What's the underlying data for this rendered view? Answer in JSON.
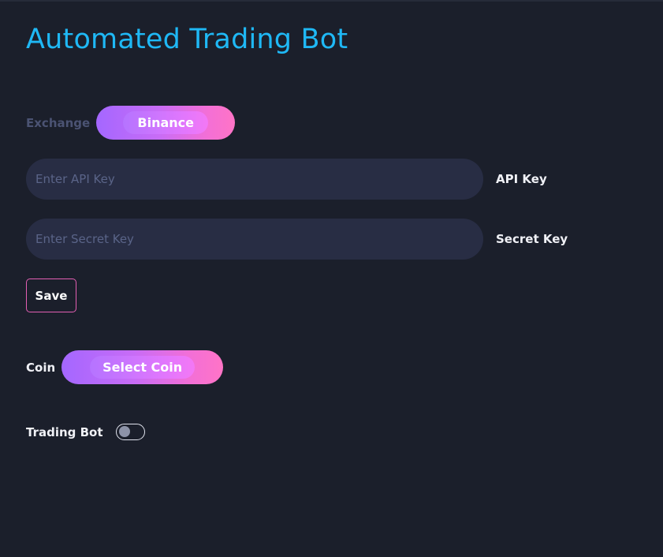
{
  "header": {
    "title": "Automated Trading Bot"
  },
  "exchange": {
    "label": "Exchange",
    "selected": "Binance"
  },
  "api_key": {
    "placeholder": "Enter API Key",
    "value": "",
    "label": "API Key"
  },
  "secret_key": {
    "placeholder": "Enter Secret Key",
    "value": "",
    "label": "Secret Key"
  },
  "save": {
    "label": "Save"
  },
  "coin": {
    "label": "Coin",
    "selected": "Select Coin"
  },
  "trading_bot": {
    "label": "Trading Bot",
    "enabled": false
  },
  "colors": {
    "background": "#1b1f2b",
    "title": "#1fb8f5",
    "input_bg": "#282d44",
    "accent_start": "#a467ff",
    "accent_end": "#ff74c6",
    "save_border": "#e35fb3"
  }
}
